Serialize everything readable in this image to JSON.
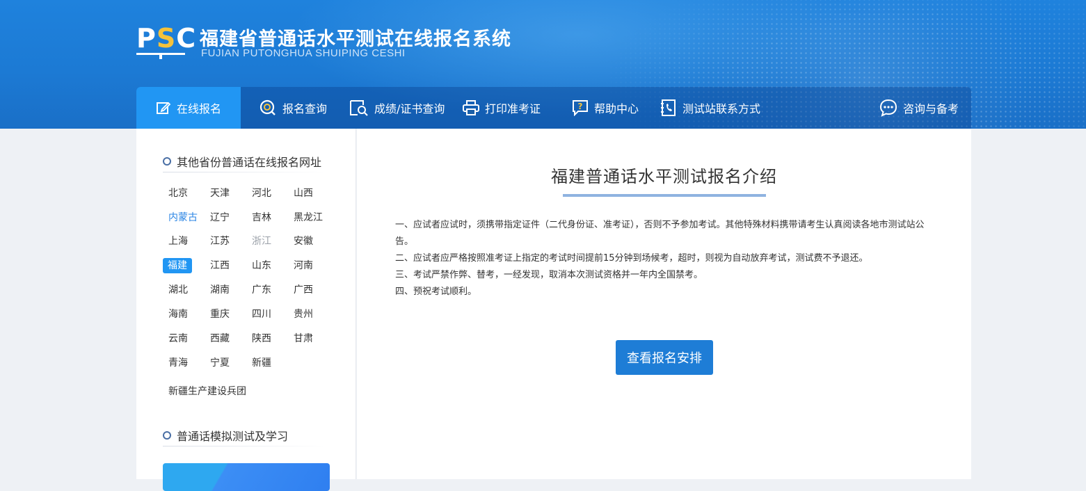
{
  "header": {
    "logo_text_p": "P",
    "logo_text_s": "S",
    "logo_text_c": "C",
    "title": "福建省普通话水平测试在线报名系统",
    "subtitle": "FUJIAN PUTONGHUA SHUIPING CESHI"
  },
  "nav": {
    "items": [
      {
        "label": "在线报名",
        "icon": "edit-icon",
        "active": true
      },
      {
        "label": "报名查询",
        "icon": "search-circle-icon"
      },
      {
        "label": "成绩/证书查询",
        "icon": "document-search-icon"
      },
      {
        "label": "打印准考证",
        "icon": "printer-icon"
      },
      {
        "label": "帮助中心",
        "icon": "help-icon"
      },
      {
        "label": "测试站联系方式",
        "icon": "phone-book-icon"
      },
      {
        "label": "咨询与备考",
        "icon": "chat-icon"
      }
    ]
  },
  "sidebar": {
    "provinces_title": "其他省份普通话在线报名网址",
    "provinces": [
      [
        "北京",
        "天津",
        "河北",
        "山西"
      ],
      [
        "内蒙古",
        "辽宁",
        "吉林",
        "黑龙江"
      ],
      [
        "上海",
        "江苏",
        "浙江",
        "安徽"
      ],
      [
        "福建",
        "江西",
        "山东",
        "河南"
      ],
      [
        "湖北",
        "湖南",
        "广东",
        "广西"
      ],
      [
        "海南",
        "重庆",
        "四川",
        "贵州"
      ],
      [
        "云南",
        "西藏",
        "陕西",
        "甘肃"
      ],
      [
        "青海",
        "宁夏",
        "新疆"
      ]
    ],
    "extra_province": "新疆生产建设兵团",
    "practice_title": "普通话模拟测试及学习"
  },
  "main": {
    "title": "福建普通话水平测试报名介绍",
    "notices": [
      "一、应试者应试时，须携带指定证件（二代身份证、准考证），否则不予参加考试。其他特殊材料携带请考生认真阅读各地市测试站公告。",
      "二、应试者应严格按照准考证上指定的考试时间提前15分钟到场候考，超时，则视为自动放弃考试，测试费不予退还。",
      "三、考试严禁作弊、替考，一经发现，取消本次测试资格并一年内全国禁考。",
      "四、预祝考试顺利。"
    ],
    "cta_label": "查看报名安排"
  },
  "colors": {
    "header_blue": "#1f82dd",
    "accent": "#2196f3",
    "button": "#1e7dd6",
    "link_blue": "#2b85e4"
  }
}
